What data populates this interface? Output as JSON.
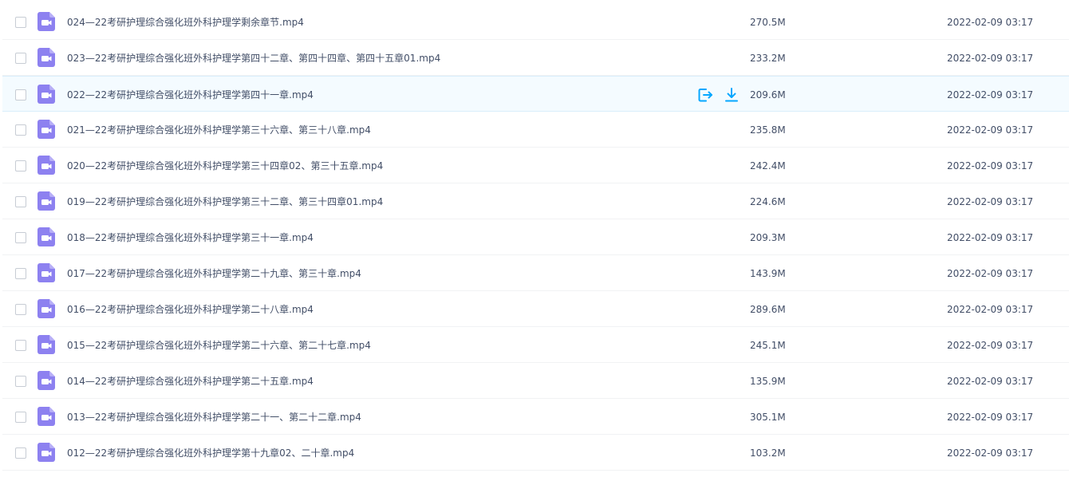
{
  "colors": {
    "icon_bg": "#8d81f0",
    "accent": "#06a7ff",
    "hover_bg": "#f4fbff"
  },
  "icons": {
    "file": "video-file-icon",
    "share": "share-export-icon",
    "download": "download-icon"
  },
  "files": [
    {
      "name": "024—22考研护理综合强化班外科护理学剩余章节.mp4",
      "size": "270.5M",
      "date": "2022-02-09 03:17"
    },
    {
      "name": "023—22考研护理综合强化班外科护理学第四十二章、第四十四章、第四十五章01.mp4",
      "size": "233.2M",
      "date": "2022-02-09 03:17"
    },
    {
      "name": "022—22考研护理综合强化班外科护理学第四十一章.mp4",
      "size": "209.6M",
      "date": "2022-02-09 03:17",
      "hover": true
    },
    {
      "name": "021—22考研护理综合强化班外科护理学第三十六章、第三十八章.mp4",
      "size": "235.8M",
      "date": "2022-02-09 03:17"
    },
    {
      "name": "020—22考研护理综合强化班外科护理学第三十四章02、第三十五章.mp4",
      "size": "242.4M",
      "date": "2022-02-09 03:17"
    },
    {
      "name": "019—22考研护理综合强化班外科护理学第三十二章、第三十四章01.mp4",
      "size": "224.6M",
      "date": "2022-02-09 03:17"
    },
    {
      "name": "018—22考研护理综合强化班外科护理学第三十一章.mp4",
      "size": "209.3M",
      "date": "2022-02-09 03:17"
    },
    {
      "name": "017—22考研护理综合强化班外科护理学第二十九章、第三十章.mp4",
      "size": "143.9M",
      "date": "2022-02-09 03:17"
    },
    {
      "name": "016—22考研护理综合强化班外科护理学第二十八章.mp4",
      "size": "289.6M",
      "date": "2022-02-09 03:17"
    },
    {
      "name": "015—22考研护理综合强化班外科护理学第二十六章、第二十七章.mp4",
      "size": "245.1M",
      "date": "2022-02-09 03:17"
    },
    {
      "name": "014—22考研护理综合强化班外科护理学第二十五章.mp4",
      "size": "135.9M",
      "date": "2022-02-09 03:17"
    },
    {
      "name": "013—22考研护理综合强化班外科护理学第二十一、第二十二章.mp4",
      "size": "305.1M",
      "date": "2022-02-09 03:17"
    },
    {
      "name": "012—22考研护理综合强化班外科护理学第十九章02、二十章.mp4",
      "size": "103.2M",
      "date": "2022-02-09 03:17"
    }
  ]
}
